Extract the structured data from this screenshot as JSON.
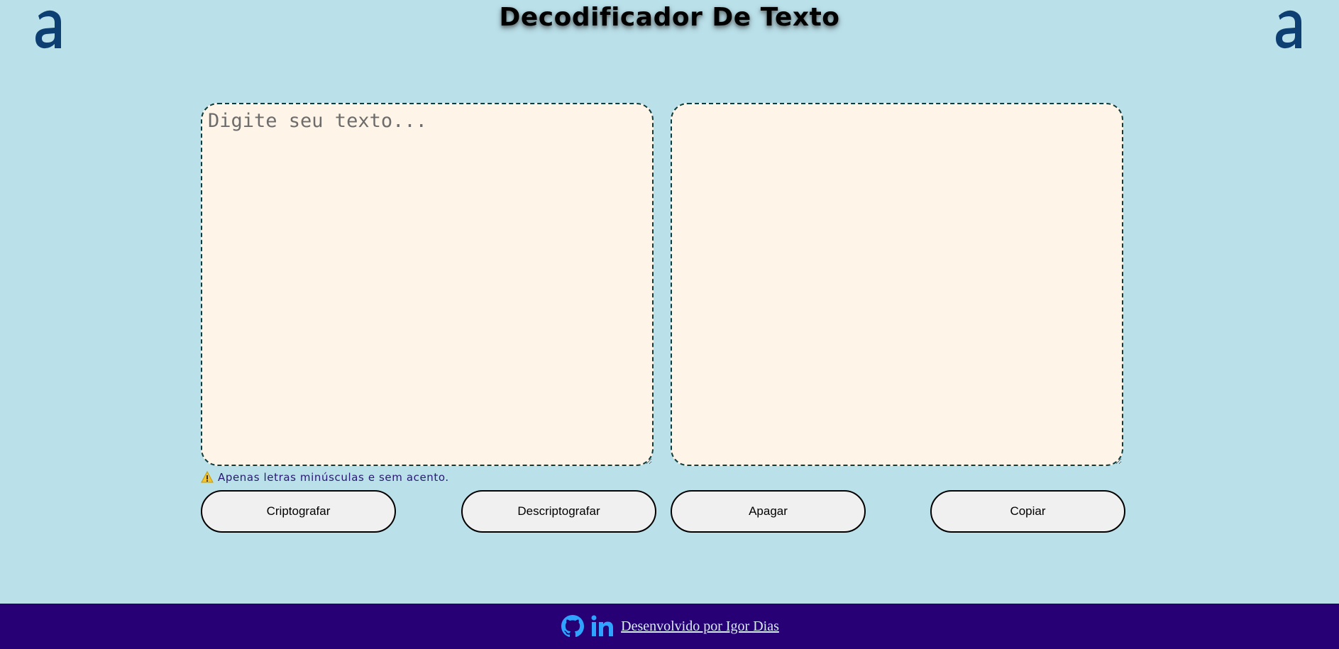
{
  "header": {
    "title": "Decodificador De Texto",
    "logo_left_icon": "alura-a-logo-icon",
    "logo_right_icon": "alura-a-logo-icon"
  },
  "editor": {
    "input_placeholder": "Digite seu texto...",
    "input_value": "",
    "output_value": ""
  },
  "warning": {
    "icon": "warning-icon",
    "text": "Apenas letras minúsculas e sem acento."
  },
  "buttons": {
    "encrypt_label": "Criptografar",
    "decrypt_label": "Descriptografar",
    "clear_label": "Apagar",
    "copy_label": "Copiar"
  },
  "footer": {
    "github_icon": "github-icon",
    "linkedin_icon": "linkedin-icon",
    "credit_text": "Desenvolvido por Igor Dias"
  },
  "colors": {
    "background": "#bae0ea",
    "panel": "#fff4e8",
    "footer": "#270075",
    "logo": "#0d3f73",
    "social_icons": "#2ea4ff",
    "warning_text": "#2a1875"
  }
}
